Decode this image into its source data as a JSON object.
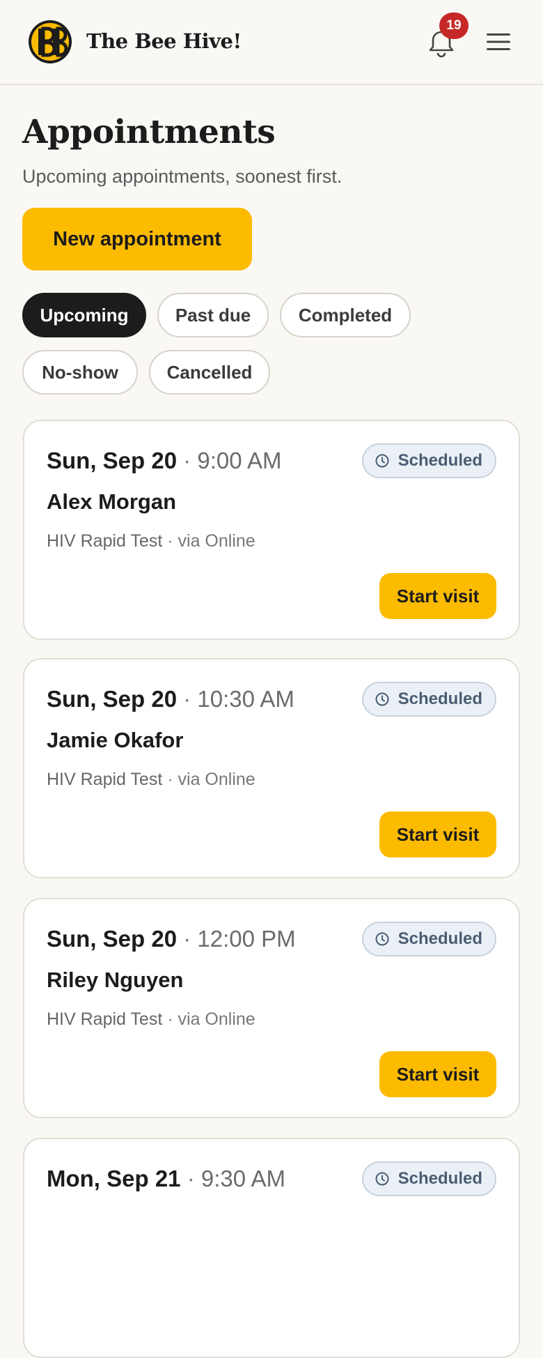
{
  "header": {
    "brand": "The Bee Hive!",
    "notification_count": "19"
  },
  "page": {
    "title": "Appointments",
    "subtitle": "Upcoming appointments, soonest first.",
    "new_button": "New appointment"
  },
  "filters": [
    {
      "label": "Upcoming",
      "active": true
    },
    {
      "label": "Past due",
      "active": false
    },
    {
      "label": "Completed",
      "active": false
    },
    {
      "label": "No-show",
      "active": false
    },
    {
      "label": "Cancelled",
      "active": false
    }
  ],
  "appointments": [
    {
      "date": "Sun, Sep 20",
      "sep": "·",
      "time": "9:00 AM",
      "status": "Scheduled",
      "patient": "Alex Morgan",
      "test": "HIV Rapid Test",
      "via": "· via Online",
      "action": "Start visit"
    },
    {
      "date": "Sun, Sep 20",
      "sep": "·",
      "time": "10:30 AM",
      "status": "Scheduled",
      "patient": "Jamie Okafor",
      "test": "HIV Rapid Test",
      "via": "· via Online",
      "action": "Start visit"
    },
    {
      "date": "Sun, Sep 20",
      "sep": "·",
      "time": "12:00 PM",
      "status": "Scheduled",
      "patient": "Riley Nguyen",
      "test": "HIV Rapid Test",
      "via": "· via Online",
      "action": "Start visit"
    },
    {
      "date": "Mon, Sep 21",
      "sep": "·",
      "time": "9:30 AM",
      "status": "Scheduled",
      "patient": "",
      "test": "",
      "via": "",
      "action": ""
    }
  ],
  "colors": {
    "accent": "#fdbb00",
    "badge": "#c62828",
    "status_bg": "#eaf0f6"
  },
  "icons": {
    "logo": "bee-hive-logo",
    "bell": "bell-icon",
    "menu": "hamburger-menu-icon",
    "status": "clock-icon"
  }
}
